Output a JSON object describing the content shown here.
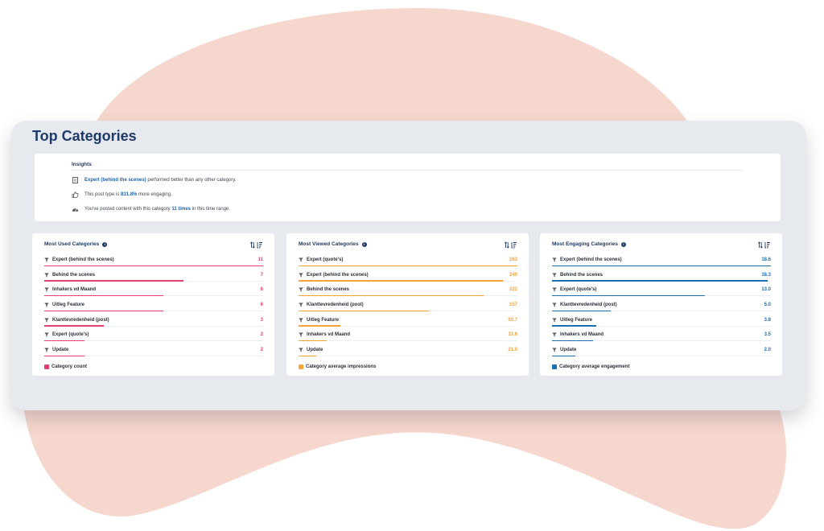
{
  "page_title": "Top Categories",
  "insights": {
    "title": "Insights",
    "line1": {
      "highlight": "Expert (behind the scenes)",
      "rest": " performed better than any other category."
    },
    "line2": {
      "before": "This post type is ",
      "highlight": "831.8%",
      "after": " more engaging."
    },
    "line3": {
      "before": "You've posted content with this category ",
      "highlight": "11 times",
      "after": " in this time range."
    }
  },
  "colors": {
    "pink": "#e43f6f",
    "orange": "#f5a23a",
    "blue": "#1f6fb5"
  },
  "panels": [
    {
      "title": "Most Used Categories",
      "legend": "Category count",
      "color": "#e43f6f",
      "rows": [
        {
          "label": "Expert (behind the scenes)",
          "value": "11",
          "fraction": 1.0
        },
        {
          "label": "Behind the scenes",
          "value": "7",
          "fraction": 0.636
        },
        {
          "label": "Inhakers vd Maand",
          "value": "6",
          "fraction": 0.545
        },
        {
          "label": "Uitleg Feature",
          "value": "6",
          "fraction": 0.545
        },
        {
          "label": "Klanttevredenheid (post)",
          "value": "3",
          "fraction": 0.273
        },
        {
          "label": "Expert (quote's)",
          "value": "2",
          "fraction": 0.182
        },
        {
          "label": "Update",
          "value": "2",
          "fraction": 0.182
        }
      ]
    },
    {
      "title": "Most Viewed Categories",
      "legend": "Category average impressions",
      "color": "#f5a23a",
      "rows": [
        {
          "label": "Expert (quote's)",
          "value": "263",
          "fraction": 1.0
        },
        {
          "label": "Expert (behind the scenes)",
          "value": "245",
          "fraction": 0.932
        },
        {
          "label": "Behind the scenes",
          "value": "222",
          "fraction": 0.844
        },
        {
          "label": "Klanttevredenheid (post)",
          "value": "157",
          "fraction": 0.597
        },
        {
          "label": "Uitleg Feature",
          "value": "50.7",
          "fraction": 0.193
        },
        {
          "label": "Inhakers vd Maand",
          "value": "33.6",
          "fraction": 0.128
        },
        {
          "label": "Update",
          "value": "21.0",
          "fraction": 0.08
        }
      ]
    },
    {
      "title": "Most Engaging Categories",
      "legend": "Category average engagement",
      "color": "#1f6fb5",
      "rows": [
        {
          "label": "Expert (behind the scenes)",
          "value": "18.6",
          "fraction": 1.0
        },
        {
          "label": "Behind the scenes",
          "value": "18.3",
          "fraction": 0.984
        },
        {
          "label": "Expert (quote's)",
          "value": "13.0",
          "fraction": 0.699
        },
        {
          "label": "Klanttevredenheid (post)",
          "value": "5.0",
          "fraction": 0.269
        },
        {
          "label": "Uitleg Feature",
          "value": "3.8",
          "fraction": 0.204
        },
        {
          "label": "Inhakers vd Maand",
          "value": "3.5",
          "fraction": 0.188
        },
        {
          "label": "Update",
          "value": "2.0",
          "fraction": 0.108
        }
      ]
    }
  ]
}
